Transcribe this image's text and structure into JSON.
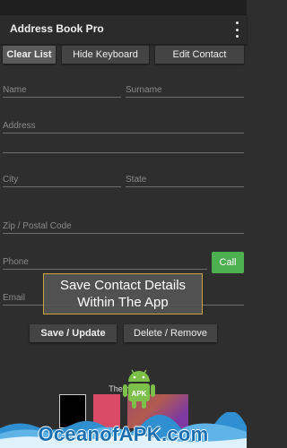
{
  "app": {
    "title": "Address Book Pro"
  },
  "toolbar": {
    "clear_list": "Clear List",
    "hide_keyboard": "Hide Keyboard",
    "edit_contact": "Edit Contact"
  },
  "form": {
    "name": {
      "placeholder": "Name",
      "value": ""
    },
    "surname": {
      "placeholder": "Surname",
      "value": ""
    },
    "address": {
      "placeholder": "Address",
      "value": ""
    },
    "city": {
      "placeholder": "City",
      "value": ""
    },
    "state": {
      "placeholder": "State",
      "value": ""
    },
    "zip": {
      "placeholder": "Zip / Postal Code",
      "value": ""
    },
    "phone": {
      "placeholder": "Phone",
      "value": ""
    },
    "email": {
      "placeholder": "Email",
      "value": ""
    },
    "call_label": "Call"
  },
  "actions": {
    "save_update": "Save  / Update",
    "delete_remove": "Delete / Remove"
  },
  "promo": {
    "line1": "Save Contact Details",
    "line2": "Within The App"
  },
  "themes": {
    "label": "Themes"
  },
  "watermark": {
    "text": "OceanofAPK.com",
    "badge": "APK"
  },
  "colors": {
    "background": "#2e2e2e",
    "call_button": "#4caf50",
    "watermark_text": "#1a6fb0"
  }
}
